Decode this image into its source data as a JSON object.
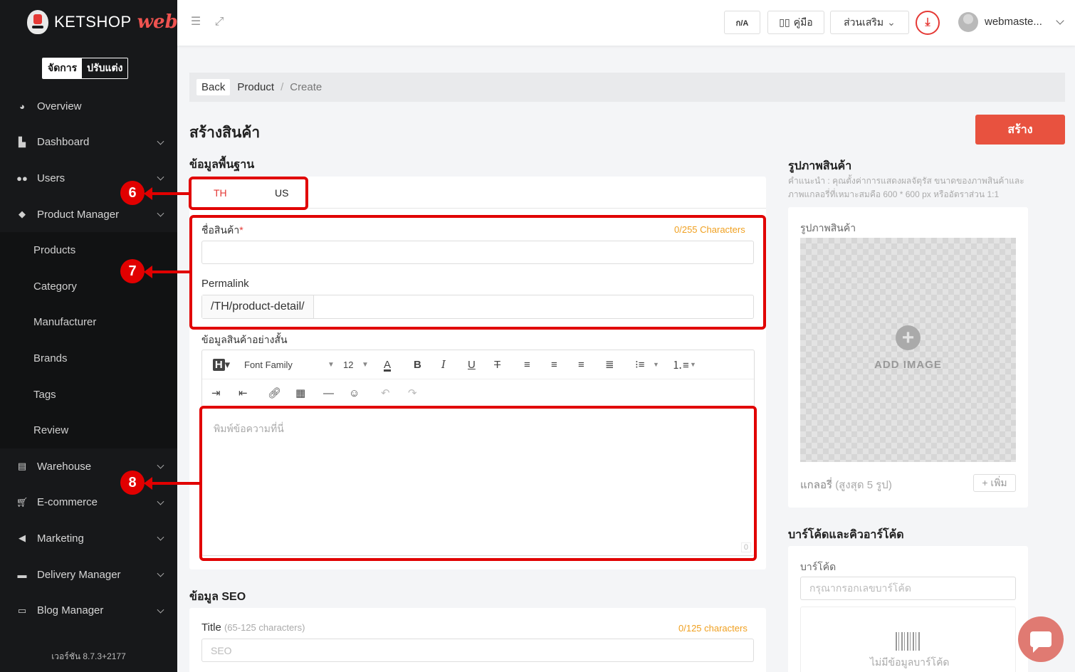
{
  "brand": {
    "name": "KETSHOP",
    "suffix": "web"
  },
  "mode_toggle": {
    "manage": "จัดการ",
    "customize": "ปรับแต่ง"
  },
  "sidebar": {
    "items": [
      {
        "label": "Overview",
        "icon": "pie-chart-icon",
        "has_children": false
      },
      {
        "label": "Dashboard",
        "icon": "bar-chart-icon",
        "has_children": true
      },
      {
        "label": "Users",
        "icon": "users-icon",
        "has_children": true
      },
      {
        "label": "Product Manager",
        "icon": "tags-icon",
        "has_children": true
      }
    ],
    "product_sub": [
      "Products",
      "Category",
      "Manufacturer",
      "Brands",
      "Tags",
      "Review"
    ],
    "items_after": [
      {
        "label": "Warehouse",
        "icon": "warehouse-icon",
        "has_children": true
      },
      {
        "label": "E-commerce",
        "icon": "cart-icon",
        "has_children": true
      },
      {
        "label": "Marketing",
        "icon": "megaphone-icon",
        "has_children": true
      },
      {
        "label": "Delivery Manager",
        "icon": "truck-icon",
        "has_children": true
      },
      {
        "label": "Blog Manager",
        "icon": "newspaper-icon",
        "has_children": true
      }
    ],
    "version": "เวอร์ชัน 8.7.3+2177"
  },
  "topbar": {
    "lang_btn": "ก/A",
    "manual_btn": "คู่มือ",
    "addons_btn": "ส่วนเสริม",
    "user_name": "webmaste..."
  },
  "breadcrumb": {
    "back": "Back",
    "section": "Product",
    "current": "Create"
  },
  "page": {
    "title": "สร้างสินค้า",
    "create_btn": "สร้าง"
  },
  "basic_info": {
    "title": "ข้อมูลพื้นฐาน",
    "tabs": [
      "TH",
      "US"
    ],
    "active_tab": "TH",
    "name_label": "ชื่อสินค้า",
    "name_required": "*",
    "name_counter": "0/255 Characters",
    "name_value": "",
    "permalink_label": "Permalink",
    "permalink_prefix": "/TH/product-detail/",
    "permalink_value": "",
    "short_desc_label": "ข้อมูลสินค้าอย่างสั้น",
    "editor_placeholder": "พิมพ์ข้อความที่นี่",
    "editor_count": "0",
    "font_family": "Font Family",
    "font_size": "12"
  },
  "seo": {
    "title": "ข้อมูล SEO",
    "title_label": "Title",
    "title_hint": "(65-125 characters)",
    "title_counter": "0/125 characters",
    "title_placeholder": "SEO"
  },
  "product_image": {
    "section_title": "รูปภาพสินค้า",
    "hint": "คำแนะนำ : คุณตั้งค่าการแสดงผลจัตุรัส ขนาดของภาพสินค้าและภาพแกลอรี่ที่เหมาะสมคือ 600 * 600 px หรืออัตราส่วน 1:1",
    "card_label": "รูปภาพสินค้า",
    "add_image": "ADD IMAGE",
    "gallery_label": "แกลอรี่",
    "gallery_limit": "(สูงสุด 5 รูป)",
    "add_btn": "+ เพิ่ม"
  },
  "barcode": {
    "section_title": "บาร์โค้ดและคิวอาร์โค้ด",
    "label": "บาร์โค้ด",
    "placeholder": "กรุณากรอกเลขบาร์โค้ด",
    "empty_text": "ไม่มีข้อมูลบาร์โค้ด"
  },
  "annotations": [
    "6",
    "7",
    "8"
  ],
  "colors": {
    "accent": "#e8523f",
    "annotation": "#e10000",
    "sidebar": "#17181a",
    "counter": "#f0a020"
  }
}
